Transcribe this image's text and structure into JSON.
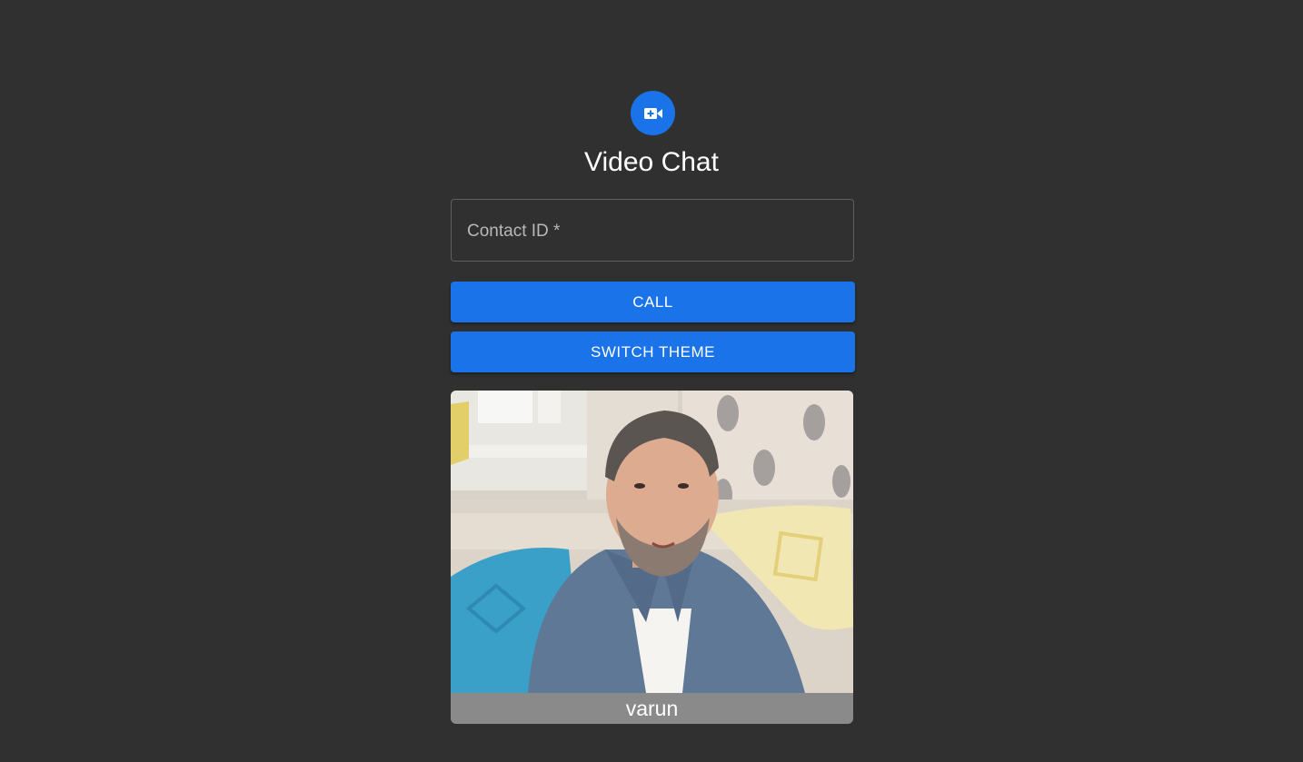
{
  "header": {
    "icon": "video-call-icon",
    "title": "Video Chat"
  },
  "form": {
    "contact_label": "Contact ID *",
    "contact_value": "",
    "call_label": "CALL",
    "switch_theme_label": "SWITCH THEME"
  },
  "video": {
    "participant_name": "varun"
  },
  "colors": {
    "background": "#303030",
    "accent": "#1a73e8",
    "name_bar": "#8a8a8a"
  }
}
